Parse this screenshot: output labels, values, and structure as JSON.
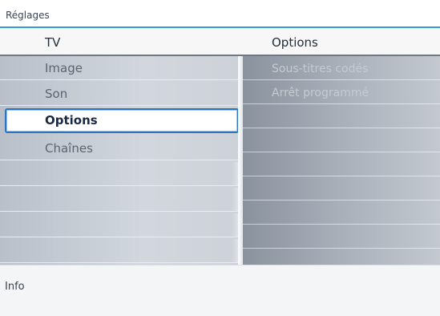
{
  "window": {
    "title": "Réglages"
  },
  "header": {
    "left_title": "TV",
    "right_title": "Options"
  },
  "menu": {
    "items": [
      {
        "label": "Image"
      },
      {
        "label": "Son"
      },
      {
        "label": "Options",
        "selected": true
      },
      {
        "label": "Chaînes"
      }
    ]
  },
  "submenu": {
    "items": [
      {
        "label": "Sous-titres codés"
      },
      {
        "label": "Arrêt programmé"
      }
    ]
  },
  "footer": {
    "info_label": "Info"
  },
  "colors": {
    "accent": "#2a74c2",
    "title_rule": "#2f9fd8"
  }
}
